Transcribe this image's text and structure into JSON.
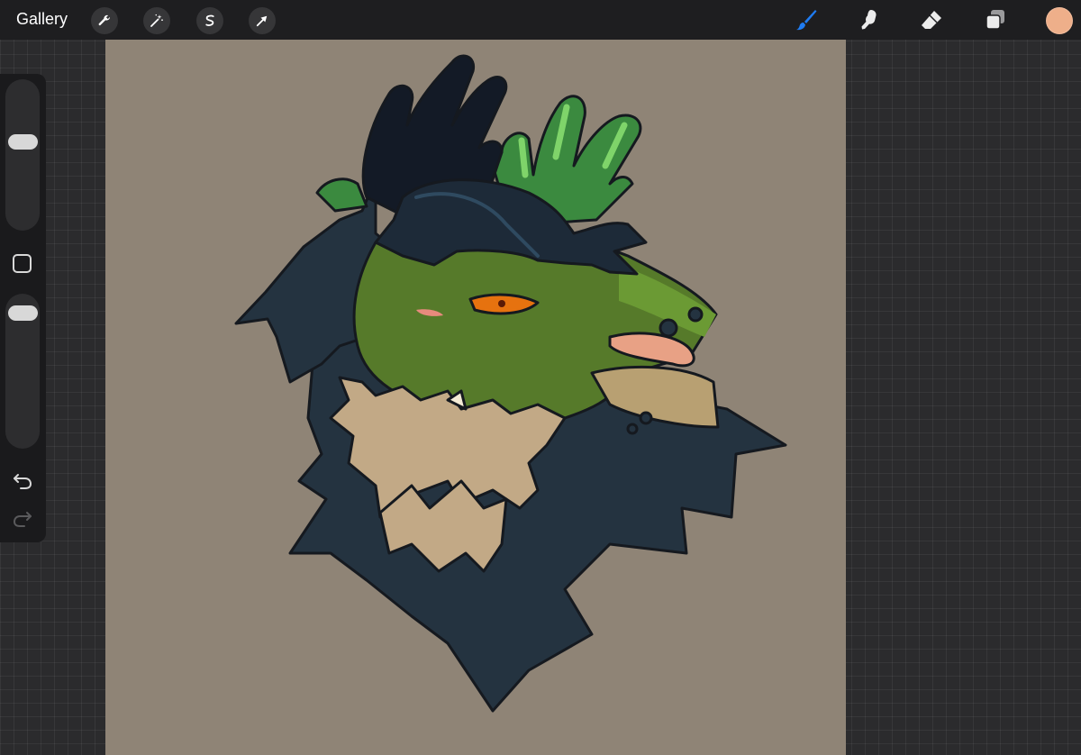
{
  "topbar": {
    "gallery_label": "Gallery",
    "left_tools": [
      {
        "name": "actions",
        "icon": "wrench-icon"
      },
      {
        "name": "adjustments",
        "icon": "magic-wand-icon"
      },
      {
        "name": "selection",
        "icon": "selection-s-icon"
      },
      {
        "name": "transform",
        "icon": "arrow-cursor-icon"
      }
    ],
    "right_tools": [
      {
        "name": "brush",
        "icon": "brush-icon",
        "active": true
      },
      {
        "name": "smudge",
        "icon": "smudge-icon",
        "active": false
      },
      {
        "name": "eraser",
        "icon": "eraser-icon",
        "active": false
      },
      {
        "name": "layers",
        "icon": "layers-icon",
        "active": false
      }
    ],
    "current_color": "#eeaf8a",
    "active_tool_color": "#1f7cf2"
  },
  "sidebar": {
    "brush_size": 0.6,
    "opacity": 0.93,
    "icons": [
      "undo-icon",
      "redo-icon"
    ]
  },
  "canvas": {
    "background_color": "#8f8476",
    "artwork": "character-illustration"
  }
}
